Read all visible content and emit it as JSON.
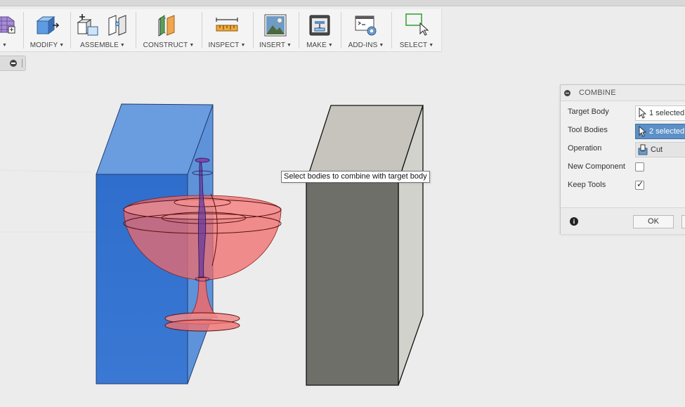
{
  "toolbar": {
    "groups": [
      {
        "label": ""
      },
      {
        "label": "MODIFY"
      },
      {
        "label": "ASSEMBLE"
      },
      {
        "label": "CONSTRUCT"
      },
      {
        "label": "INSPECT"
      },
      {
        "label": "INSERT"
      },
      {
        "label": "MAKE"
      },
      {
        "label": "ADD-INS"
      },
      {
        "label": "SELECT"
      }
    ],
    "caret": "▼"
  },
  "tooltip": {
    "text": "Select bodies to combine with target body"
  },
  "combine_panel": {
    "title": "COMBINE",
    "target_body": {
      "label": "Target Body",
      "value": "1 selected"
    },
    "tool_bodies": {
      "label": "Tool Bodies",
      "value": "2 selected"
    },
    "operation": {
      "label": "Operation",
      "value": "Cut"
    },
    "new_component": {
      "label": "New Component",
      "checked": false
    },
    "keep_tools": {
      "label": "Keep Tools",
      "checked": true,
      "mark": "✓"
    },
    "info_symbol": "i",
    "ok_label": "OK"
  },
  "colors": {
    "target_body": "#3a77cf",
    "tool_body_red": "#f06060",
    "gray_body": "#6f6f6a",
    "active_field": "#5c90c6"
  }
}
